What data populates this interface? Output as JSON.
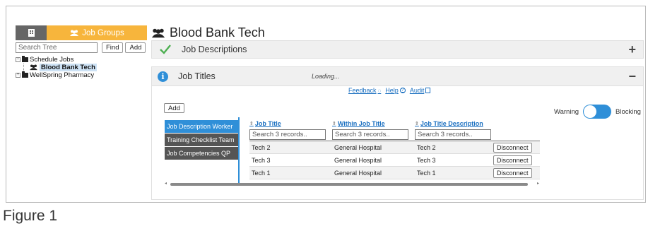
{
  "left_panel": {
    "tab_building_icon": "building-icon",
    "tab_groups_label": "Job Groups",
    "search_placeholder": "Search Tree",
    "find_label": "Find",
    "add_label": "Add",
    "tree": [
      {
        "label": "Schedule Jobs",
        "expanded": true
      },
      {
        "label": "Blood Bank Tech",
        "selected": true
      },
      {
        "label": "WellSpring Pharmacy",
        "expanded": false
      }
    ]
  },
  "main": {
    "title": "Blood Bank Tech",
    "sections": [
      {
        "label": "Job Descriptions",
        "status_icon": "check-icon",
        "toggle": "+"
      },
      {
        "label": "Job Titles",
        "status_icon": "info-icon",
        "toggle": "−",
        "status_text": "Loading..."
      }
    ],
    "links": [
      {
        "label": "Feedback",
        "icon": "speech-bubble-icon",
        "glyph": "💬"
      },
      {
        "label": "Help",
        "icon": "help-icon",
        "glyph": "?"
      },
      {
        "label": "Audit",
        "icon": "audit-icon",
        "glyph": "⎘"
      }
    ],
    "add_label": "Add",
    "switch": {
      "left_label": "Warning",
      "right_label": "Blocking",
      "state": "on",
      "color": "#2f8fd8"
    },
    "side_list": [
      {
        "label": "Job Description Worker",
        "active": true
      },
      {
        "label": "Training Checklist Team",
        "active": false
      },
      {
        "label": "Job Competencies QP",
        "active": false
      }
    ],
    "grid": {
      "columns": [
        "Job Title",
        "Within Job Title",
        "Job Title Description"
      ],
      "filter_placeholder": "Search 3 records..",
      "rows": [
        {
          "title": "Tech 2",
          "within": "General Hospital",
          "description": "Tech 2",
          "action": "Disconnect"
        },
        {
          "title": "Tech 3",
          "within": "General Hospital",
          "description": "Tech 3",
          "action": "Disconnect"
        },
        {
          "title": "Tech 1",
          "within": "General Hospital",
          "description": "Tech 1",
          "action": "Disconnect"
        }
      ]
    }
  },
  "caption": "Figure 1",
  "colors": {
    "accent_orange": "#f7b53c",
    "accent_blue": "#2f8fd8",
    "check_green": "#4caf50"
  }
}
